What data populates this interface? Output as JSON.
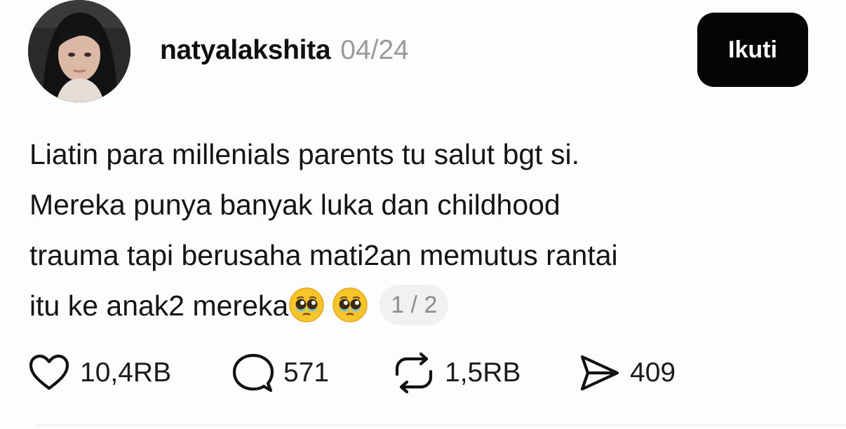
{
  "post": {
    "username": "natyalakshita",
    "date": "04/24",
    "follow_label": "Ikuti",
    "body_lines": [
      "Liatin para millenials parents tu salut bgt si.",
      "Mereka punya banyak luka dan childhood",
      "trauma tapi berusaha mati2an memutus rantai",
      "itu ke anak2 mereka"
    ],
    "emojis": [
      "pleading-face-emoji",
      "pleading-face-emoji"
    ],
    "page_indicator": "1 / 2"
  },
  "actions": {
    "like": {
      "icon": "heart-icon",
      "count": "10,4RB"
    },
    "reply": {
      "icon": "comment-bubble-icon",
      "count": "571"
    },
    "repost": {
      "icon": "repost-icon",
      "count": "1,5RB"
    },
    "share": {
      "icon": "send-icon",
      "count": "409"
    }
  },
  "colors": {
    "background": "#fdfdfd",
    "text": "#141414",
    "muted": "#9a9a9a",
    "button": "#050505",
    "button_text": "#ffffff",
    "emoji_face": "#f7c52b"
  }
}
